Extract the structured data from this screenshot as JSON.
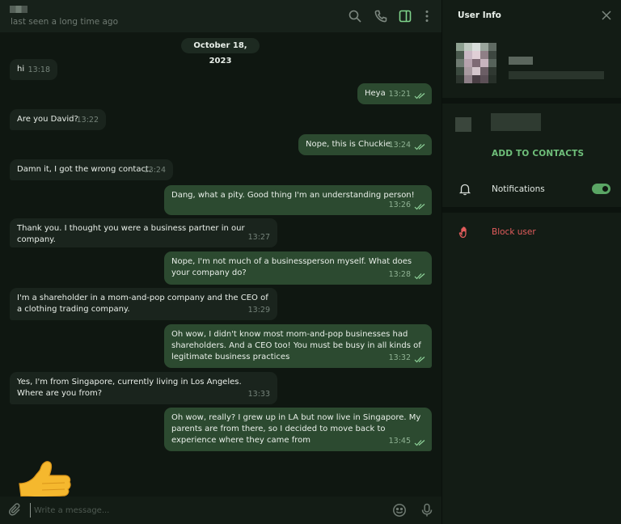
{
  "header": {
    "contact_status": "last seen a long time ago",
    "icons": [
      "search-icon",
      "phone-icon",
      "sidebar-toggle-icon",
      "more-vertical-icon"
    ]
  },
  "chat": {
    "date_label": "October 18, 2023",
    "messages": [
      {
        "dir": "in",
        "text": "hi",
        "time": "13:18"
      },
      {
        "dir": "out",
        "text": "Heya",
        "time": "13:21"
      },
      {
        "dir": "in",
        "text": "Are you David?",
        "time": "13:22"
      },
      {
        "dir": "out",
        "text": "Nope, this is Chuckie",
        "time": "13:24"
      },
      {
        "dir": "in",
        "text": "Damn it, I got the wrong contact.",
        "time": "13:24"
      },
      {
        "dir": "out",
        "text": "Dang, what a pity. Good thing I'm an understanding person!",
        "time": "13:26"
      },
      {
        "dir": "in",
        "text": "Thank you. I thought you were a business partner in our company.",
        "time": "13:27"
      },
      {
        "dir": "out",
        "text": "Nope, I'm not much of a businessperson myself. What does your company do?",
        "time": "13:28"
      },
      {
        "dir": "in",
        "text": "I'm a shareholder in a mom-and-pop company and the CEO of a clothing trading company.",
        "time": "13:29"
      },
      {
        "dir": "out",
        "text": "Oh wow, I didn't know most mom-and-pop businesses had shareholders. And a CEO too! You must be busy in all kinds of legitimate business practices",
        "time": "13:32"
      },
      {
        "dir": "in",
        "text": "Yes, I'm from Singapore, currently living in Los Angeles. Where are you from?",
        "time": "13:33"
      },
      {
        "dir": "out",
        "text": "Oh wow, really? I grew up in LA but now live in Singapore. My parents are from there, so I decided to move back to experience where they came from",
        "time": "13:45"
      }
    ],
    "sticker": "thumbs-up-emoji"
  },
  "composer": {
    "placeholder": "Write a message...",
    "icons": [
      "attach-icon",
      "emoji-icon",
      "microphone-icon"
    ]
  },
  "info_panel": {
    "title": "User Info",
    "add_contacts": "ADD TO CONTACTS",
    "notifications_label": "Notifications",
    "notifications_on": true,
    "block_user": "Block user"
  },
  "colors": {
    "accent_green": "#6fbf7a",
    "outgoing_bubble": "#2c4a30",
    "incoming_bubble": "#1a241d",
    "danger": "#e25c5c"
  }
}
